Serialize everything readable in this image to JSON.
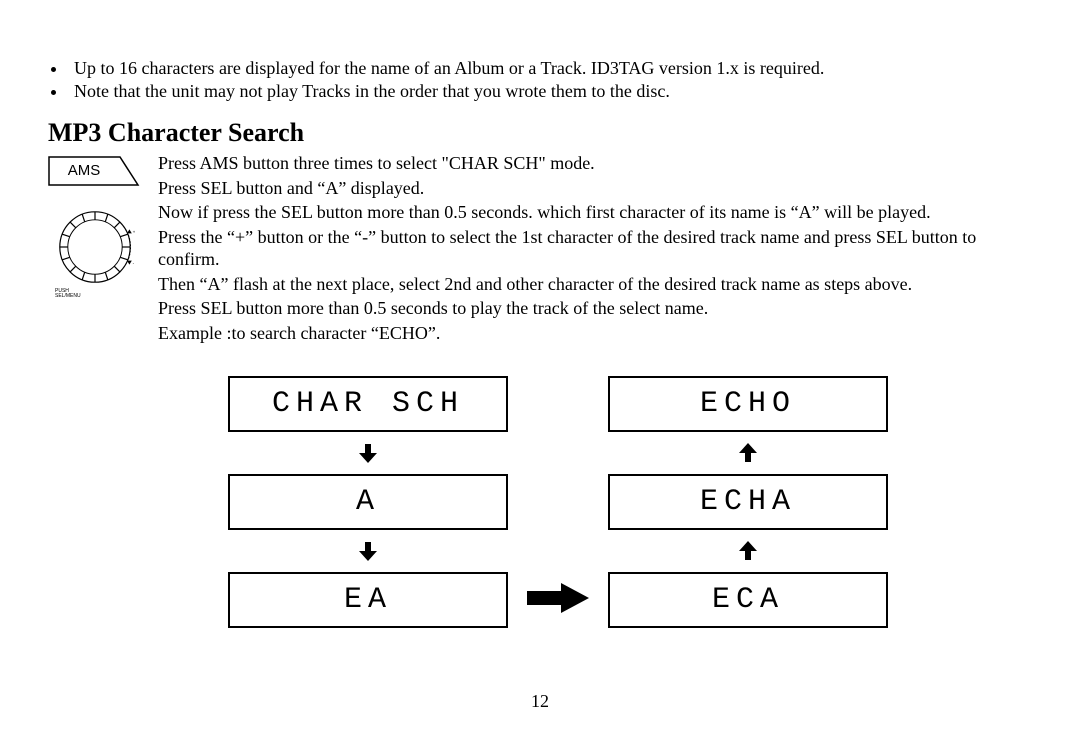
{
  "bullets": [
    "Up to 16 characters are displayed for the name of an Album or a Track. ID3TAG version 1.x is required.",
    "Note that the unit may not play Tracks in the order that you wrote them to the disc."
  ],
  "section_title": "MP3 Character Search",
  "ams_label": "AMS",
  "knob_caption": "PUSH\nSEL/MENU",
  "instructions": [
    "Press AMS button three times to select \"CHAR SCH\" mode.",
    "Press SEL button and “A” displayed.",
    "Now if press the SEL button more than 0.5 seconds. which first character of its name is “A” will be played.",
    "Press the   “+” button or the “-” button to select the 1st character of the desired track name and press SEL button to confirm.",
    "Then “A” flash at the next place, select 2nd and other character of the desired track name as steps above.",
    "Press SEL button more than 0.5 seconds to play the track of the select name.",
    "Example :to search character “ECHO”."
  ],
  "displays": {
    "left": [
      "CHAR SCH",
      "A",
      "EA"
    ],
    "right": [
      "ECHO",
      "ECHA",
      "ECA"
    ]
  },
  "page_number": "12"
}
